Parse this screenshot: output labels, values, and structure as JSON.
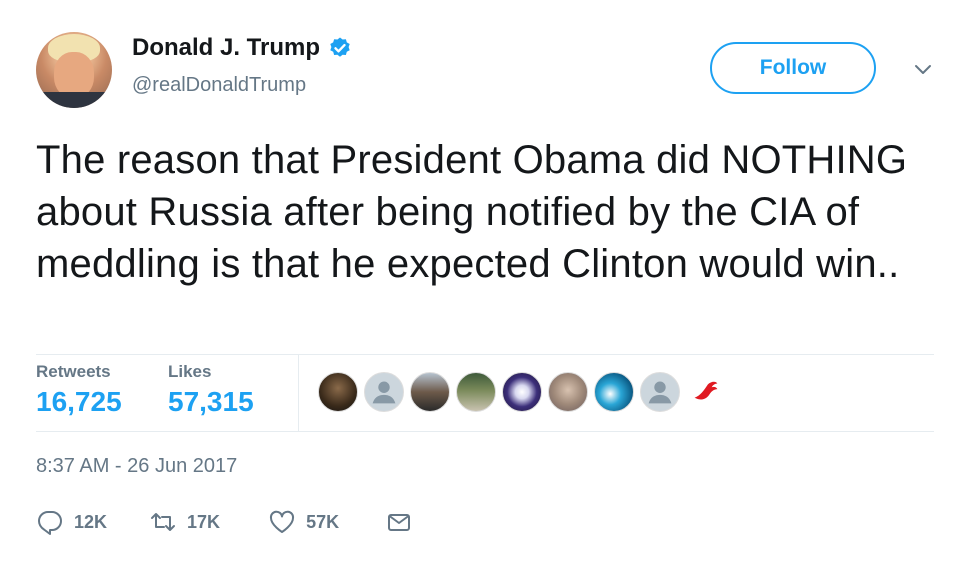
{
  "author": {
    "name": "Donald J. Trump",
    "handle": "@realDonaldTrump"
  },
  "follow_label": "Follow",
  "tweet_text": "The reason that President Obama did NOTHING about Russia after being notified by the CIA of meddling is that he expected Clinton would win..",
  "stats": {
    "retweets_label": "Retweets",
    "retweets_value": "16,725",
    "likes_label": "Likes",
    "likes_value": "57,315"
  },
  "timestamp": "8:37 AM - 26 Jun 2017",
  "actions": {
    "reply_count": "12K",
    "retweet_count": "17K",
    "like_count": "57K"
  },
  "colors": {
    "accent": "#1da1f2",
    "muted": "#657786",
    "divider": "#e6ecf0"
  },
  "icons": [
    "verified-icon",
    "chevron-down-icon",
    "reply-icon",
    "retweet-icon",
    "heart-icon",
    "mail-icon"
  ]
}
